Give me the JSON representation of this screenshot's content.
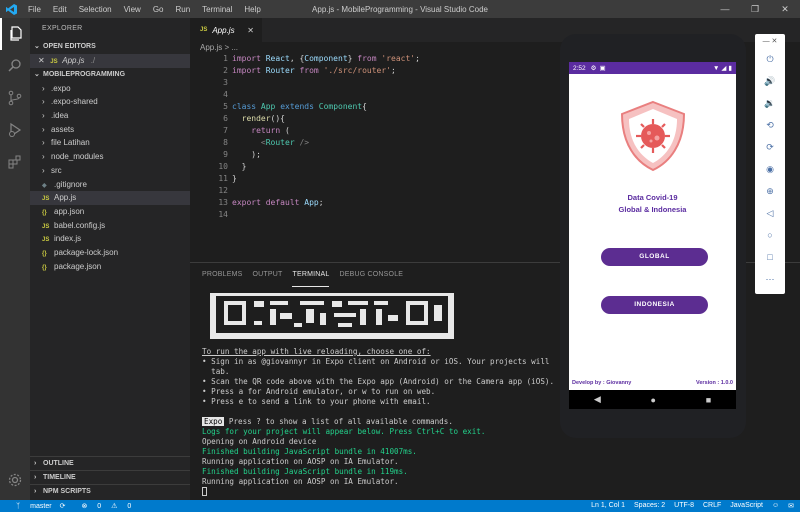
{
  "window": {
    "title": "App.js - MobileProgramming - Visual Studio Code",
    "menu": [
      "File",
      "Edit",
      "Selection",
      "View",
      "Go",
      "Run",
      "Terminal",
      "Help"
    ]
  },
  "sidebar": {
    "header": "EXPLORER",
    "open_editors_label": "OPEN EDITORS",
    "open_editor_file": "App.js",
    "open_editor_path": "./",
    "project_label": "MOBILEPROGRAMMING",
    "items": [
      {
        "label": ".expo",
        "type": "folder"
      },
      {
        "label": ".expo-shared",
        "type": "folder"
      },
      {
        "label": ".idea",
        "type": "folder"
      },
      {
        "label": "assets",
        "type": "folder"
      },
      {
        "label": "file Latihan",
        "type": "folder"
      },
      {
        "label": "node_modules",
        "type": "folder"
      },
      {
        "label": "src",
        "type": "folder"
      },
      {
        "label": ".gitignore",
        "type": "file"
      },
      {
        "label": "App.js",
        "type": "js"
      },
      {
        "label": "app.json",
        "type": "json"
      },
      {
        "label": "babel.config.js",
        "type": "js"
      },
      {
        "label": "index.js",
        "type": "js"
      },
      {
        "label": "package-lock.json",
        "type": "json"
      },
      {
        "label": "package.json",
        "type": "json"
      }
    ],
    "outline_label": "OUTLINE",
    "timeline_label": "TIMELINE",
    "npm_label": "NPM SCRIPTS"
  },
  "editor": {
    "tab_label": "App.js",
    "breadcrumb": "App.js > ...",
    "line_numbers": [
      "1",
      "2",
      "3",
      "4",
      "5",
      "6",
      "7",
      "8",
      "9",
      "10",
      "11",
      "12",
      "13",
      "14"
    ]
  },
  "panel": {
    "tabs": [
      "PROBLEMS",
      "OUTPUT",
      "TERMINAL",
      "DEBUG CONSOLE"
    ],
    "lines": {
      "l1": "To run the app with live reloading, choose one of:",
      "l2": "• Sign in as @giovannyr in Expo client on Android or iOS. Your projects will",
      "l3": "  tab.",
      "l4": "• Scan the QR code above with the Expo app (Android) or the Camera app (iOS).",
      "l5": "• Press a for Android emulator, or w to run on web.",
      "l6": "• Press e to send a link to your phone with email.",
      "expo_badge": "Expo",
      "l7": " Press ? to show a list of all available commands.",
      "l8": "Logs for your project will appear below. Press Ctrl+C to exit.",
      "l9": "Opening on Android device",
      "l10": "Finished building JavaScript bundle in 41007ms.",
      "l11": "Running application on AOSP on IA Emulator.",
      "l12": "Finished building JavaScript bundle in 119ms.",
      "l13": "Running application on AOSP on IA Emulator."
    }
  },
  "statusbar": {
    "branch": "master",
    "errors": "0",
    "warnings": "0",
    "position": "Ln 1, Col 1",
    "spaces": "Spaces: 2",
    "encoding": "UTF-8",
    "eol": "CRLF",
    "language": "JavaScript"
  },
  "emulator": {
    "time": "2:52",
    "app_title_1": "Data Covid-19",
    "app_title_2": "Global & Indonesia",
    "btn_global": "GLOBAL",
    "btn_indonesia": "INDONESIA",
    "footer_left": "Develop by : Giovanny",
    "footer_right": "Version : 1.0.0"
  },
  "colors": {
    "accent": "#007acc",
    "app_purple": "#5c2d91"
  }
}
